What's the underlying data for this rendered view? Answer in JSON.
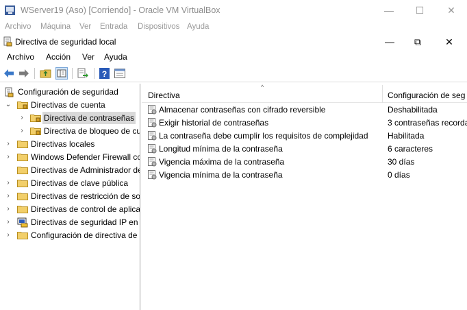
{
  "vbox": {
    "title": "WServer19 (Aso) [Corriendo] - Oracle VM VirtualBox",
    "menu": [
      "Archivo",
      "Máquina",
      "Ver",
      "Entrada",
      "Dispositivos",
      "Ayuda"
    ],
    "controls": {
      "minimize": "—",
      "maximize": "☐",
      "close": "✕"
    }
  },
  "mmc": {
    "title": "Directiva de seguridad local",
    "menu": [
      "Archivo",
      "Acción",
      "Ver",
      "Ayuda"
    ],
    "controls": {
      "minimize": "—",
      "restore": "⧉",
      "close": "✕"
    },
    "toolbar": [
      "back-icon",
      "forward-icon",
      "up-folder-icon",
      "show-hide-tree-icon",
      "export-list-icon",
      "help-icon",
      "properties-icon"
    ]
  },
  "tree": {
    "root": "Configuración de seguridad",
    "items": [
      {
        "label": "Directivas de cuenta",
        "arrow": "⌄"
      },
      {
        "label": "Directiva de contraseñas",
        "arrow": "›"
      },
      {
        "label": "Directiva de bloqueo de cu",
        "arrow": "›"
      },
      {
        "label": "Directivas locales",
        "arrow": "›"
      },
      {
        "label": "Windows Defender Firewall co",
        "arrow": "›"
      },
      {
        "label": "Directivas de Administrador de",
        "arrow": ""
      },
      {
        "label": "Directivas de clave pública",
        "arrow": "›"
      },
      {
        "label": "Directivas de restricción de sof",
        "arrow": "›"
      },
      {
        "label": "Directivas de control de aplica",
        "arrow": "›"
      },
      {
        "label": "Directivas de seguridad IP en E",
        "arrow": "›"
      },
      {
        "label": "Configuración de directiva de",
        "arrow": "›"
      }
    ]
  },
  "list": {
    "columns": [
      "Directiva",
      "Configuración de seg"
    ],
    "rows": [
      {
        "name": "Almacenar contraseñas con cifrado reversible",
        "value": "Deshabilitada"
      },
      {
        "name": "Exigir historial de contraseñas",
        "value": "3 contraseñas recorda"
      },
      {
        "name": "La contraseña debe cumplir los requisitos de complejidad",
        "value": "Habilitada"
      },
      {
        "name": "Longitud mínima de la contraseña",
        "value": "6 caracteres"
      },
      {
        "name": "Vigencia máxima de la contraseña",
        "value": "30 días"
      },
      {
        "name": "Vigencia mínima de la contraseña",
        "value": "0 días"
      }
    ]
  }
}
